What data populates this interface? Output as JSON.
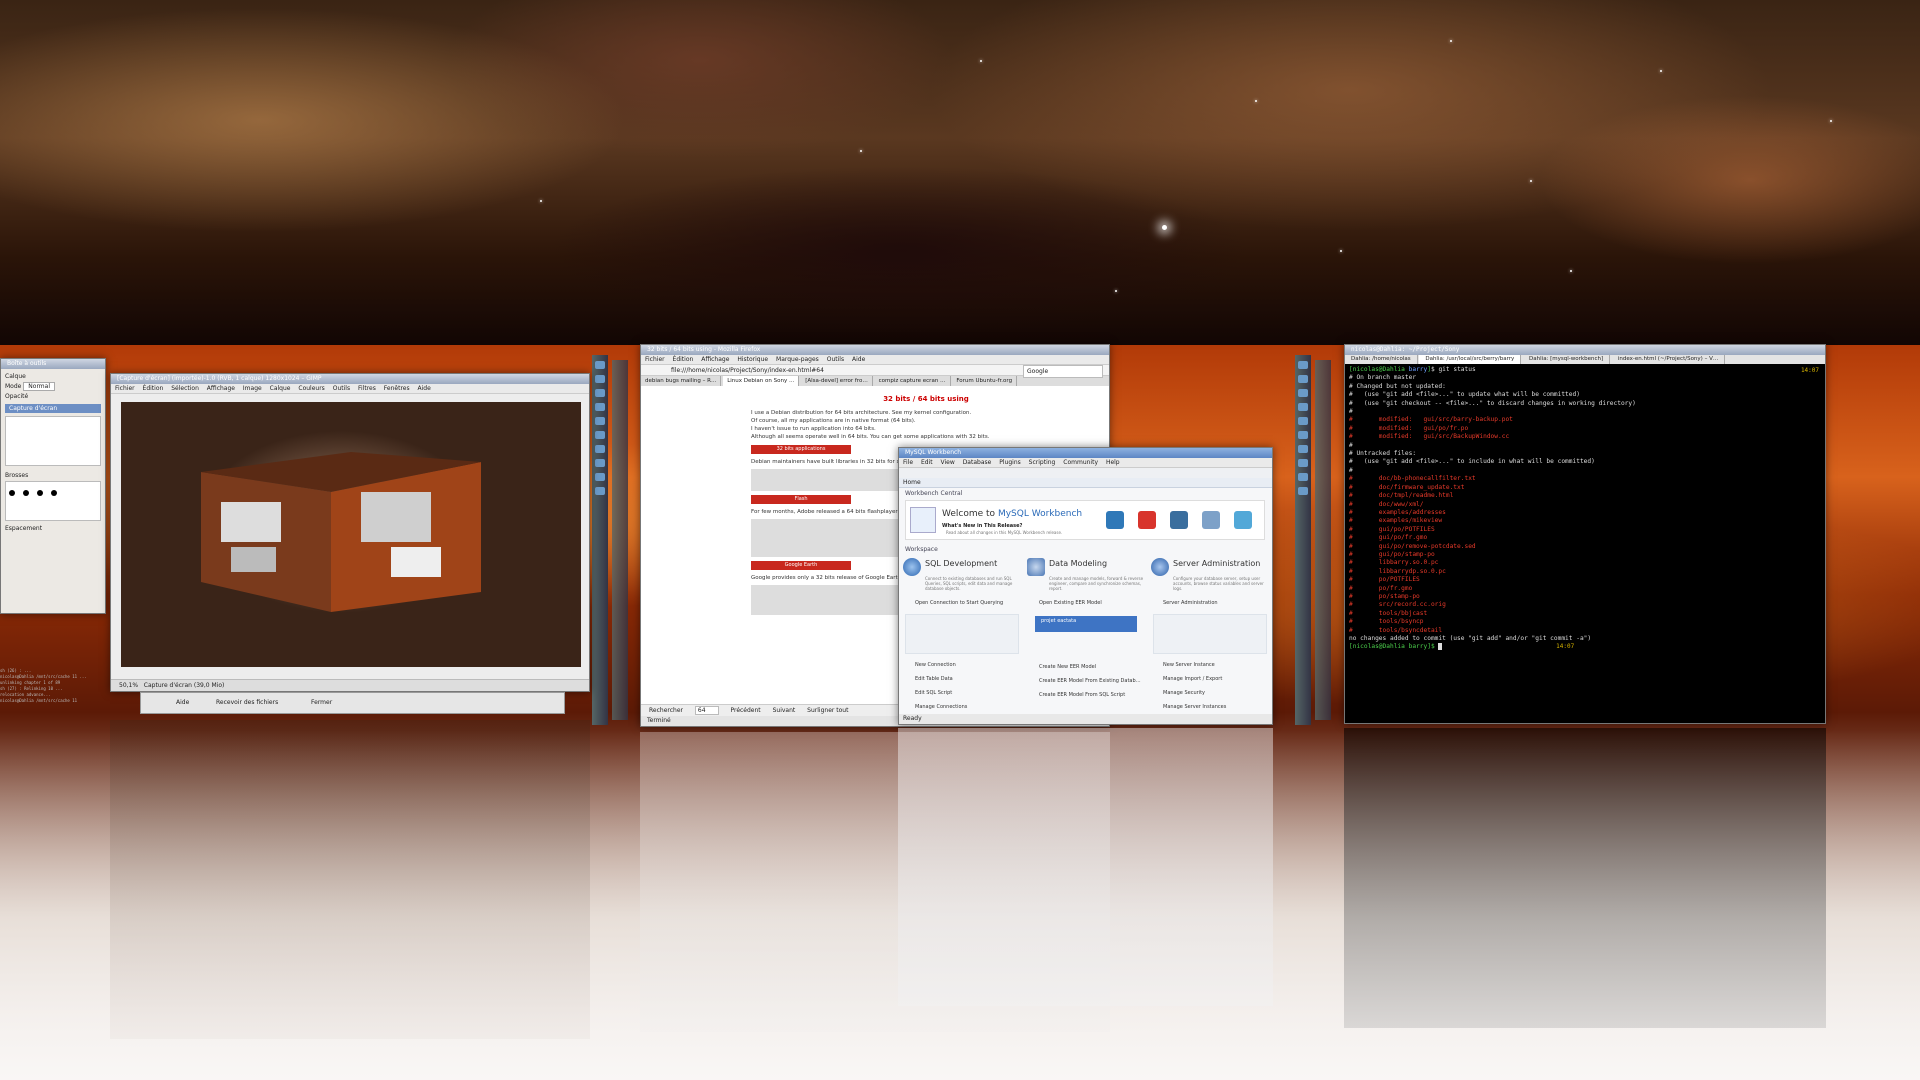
{
  "gimp": {
    "toolbox_title": "Boîte à outils",
    "image_title": "[Capture d'écran] (importée)-1.0 (RVB, 1 calque) 1280x1024 – GIMP",
    "menu": [
      "Fichier",
      "Édition",
      "Sélection",
      "Affichage",
      "Image",
      "Calque",
      "Couleurs",
      "Outils",
      "Filtres",
      "Fenêtres",
      "Aide"
    ],
    "zoom": "50,1%",
    "status": "Capture d'écran (39,0 Mio)",
    "dialog_buttons": [
      "Aide",
      "Recevoir des fichiers",
      "Fermer"
    ],
    "layer_label": "Calque",
    "mode_label": "Mode",
    "mode_value": "Normal",
    "opacity_label": "Opacité",
    "layer_name": "Capture d'écran",
    "brushes_label": "Brosses",
    "spacing_label": "Espacement"
  },
  "firefox": {
    "title": "32 bits / 64 bits using - Mozilla Firefox",
    "menu": [
      "Fichier",
      "Édition",
      "Affichage",
      "Historique",
      "Marque-pages",
      "Outils",
      "Aide"
    ],
    "url": "file:///home/nicolas/Project/Sony/index-en.html#64",
    "search_placeholder": "Google",
    "tabs": [
      "debian bugs mailing – R…",
      "Linux Debian on Sony …",
      "[Alsa-devel] error fro…",
      "compiz capture ecran …",
      "Forum Ubuntu-fr.org"
    ],
    "heading": "32 bits / 64 bits using",
    "paragraphs": [
      "I use a Debian distribution for 64 bits architecture. See my kernel configuration.",
      "Of course, all my applications are in native format (64 bits).",
      "I haven't issue to run application into 64 bits.",
      "Although all seems operate well in 64 bits. You can get some applications with 32 bits."
    ],
    "section_apps": "32 bits applications",
    "section_flash": "Flash",
    "section_earth": "Google Earth",
    "debian_note": "Debian maintainers have built libraries in 32 bits for x86_64 architecture.",
    "flash_note": "For few months, Adobe released a 64 bits flashplayer :",
    "earth_note": "Google provides only a 32 bits release of Google Earth",
    "find_label": "Rechercher",
    "find_value": "64",
    "find_prev": "Précédent",
    "find_next": "Suivant",
    "find_highlight": "Surligner tout",
    "status": "Terminé"
  },
  "workbench": {
    "title": "MySQL Workbench",
    "menu": [
      "File",
      "Edit",
      "View",
      "Database",
      "Plugins",
      "Scripting",
      "Community",
      "Help"
    ],
    "tab": "Home",
    "section_center": "Workbench Central",
    "welcome_prefix": "Welcome to ",
    "welcome_brand": "MySQL Workbench",
    "whats_new": "What's New in This Release?",
    "whats_new_sub": "Read about all changes in this MySQL Workbench release.",
    "section_workspace": "Workspace",
    "columns": [
      {
        "title": "SQL Development",
        "desc": "Connect to existing databases and run SQL Queries, SQL scripts, edit data and manage database objects.",
        "open": "Open Connection to Start Querying",
        "actions": [
          "New Connection",
          "Edit Table Data",
          "Edit SQL Script",
          "Manage Connections"
        ]
      },
      {
        "title": "Data Modeling",
        "desc": "Create and manage models, forward & reverse engineer, compare and synchronize schemas, report.",
        "open": "Open Existing EER Model",
        "model": "projet eactata",
        "actions": [
          "Create New EER Model",
          "Create EER Model From Existing Datab…",
          "Create EER Model From SQL Script"
        ]
      },
      {
        "title": "Server Administration",
        "desc": "Configure your database server, setup user accounts, browse status variables and server logs.",
        "open": "Server Administration",
        "actions": [
          "New Server Instance",
          "Manage Import / Export",
          "Manage Security",
          "Manage Server Instances"
        ]
      }
    ],
    "status": "Ready"
  },
  "terminal": {
    "title": "nicolas@Dahlia: ~/Project/Sony",
    "tabs": [
      "Dahlia: /home/nicolas",
      "Dahlia: /usr/local/src/berry/barry",
      "Dahlia: [mysql-workbench]",
      "index-en.html (~/Project/Sony) – V…"
    ],
    "prompt_user": "nicolas@Dahlia",
    "prompt_path": "barry",
    "command": "$ git status",
    "time1": "14:07",
    "time2": "14:07",
    "branch": "# On branch master",
    "changed": "# Changed but not updated:",
    "hint1": "#   (use \"git add <file>...\" to update what will be committed)",
    "hint2": "#   (use \"git checkout -- <file>...\" to discard changes in working directory)",
    "modified": [
      "#       modified:   gui/src/barry-backup.pot",
      "#       modified:   gui/po/fr.po",
      "#       modified:   gui/src/BackupWindow.cc"
    ],
    "untracked": "# Untracked files:",
    "hint3": "#   (use \"git add <file>...\" to include in what will be committed)",
    "untracked_files": [
      "#       doc/bb-phonecallfilter.txt",
      "#       doc/firmware_update.txt",
      "#       doc/tmpl/readme.html",
      "#       doc/www/xml/",
      "#       examples/addresses",
      "#       examples/mikeview",
      "#       gui/po/POTFILES",
      "#       gui/po/fr.gmo",
      "#       gui/po/remove-potcdate.sed",
      "#       gui/po/stamp-po",
      "#       libbarry.so.0.pc",
      "#       libbarrydp.so.0.pc",
      "#       po/POTFILES",
      "#       po/fr.gmo",
      "#       po/stamp-po",
      "#       src/record.cc.orig",
      "#       tools/bbjcast",
      "#       tools/bsyncp",
      "#       tools/bsyncdetail"
    ],
    "footer": "no changes added to commit (use \"git add\" and/or \"git commit -a\")",
    "prompt2": "[nicolas@Dahlia barry]$ "
  },
  "left_terminal": [
    "sh (26) : ...",
    "nicolas@Dahlia /mnt/src/cache 11 ...",
    "unlinking chapter 1 of 89",
    "sh (27) : Relinking 10 ...",
    "relocation advance...",
    "nicolas@Dahlia /mnt/src/cache 11"
  ],
  "colors": {
    "terminal_bg": "#000000",
    "prompt_green": "#4cd04c",
    "git_red": "#e83a2a",
    "workbench_blue": "#3e74c4",
    "firefox_red": "#c8281e"
  }
}
